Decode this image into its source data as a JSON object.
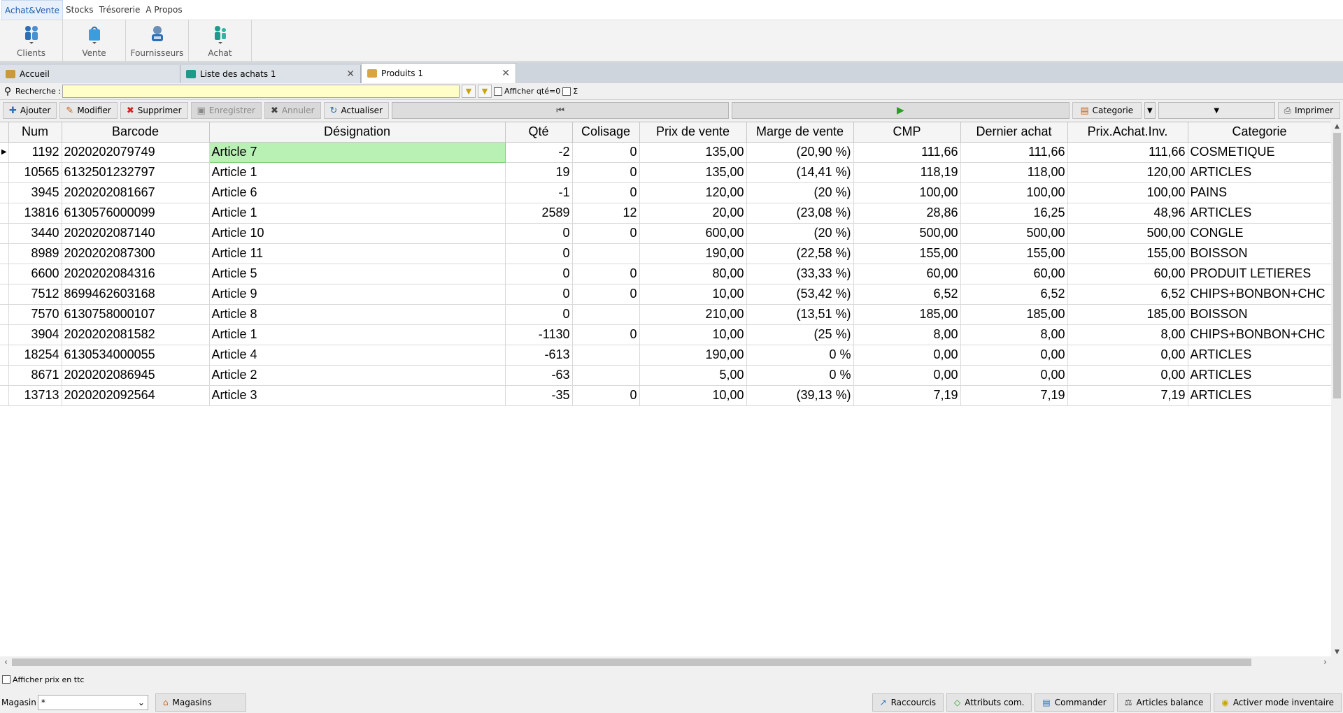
{
  "menubar": {
    "items": [
      "Achat&Vente",
      "Stocks",
      "Trésorerie",
      "A Propos"
    ]
  },
  "ribbon": {
    "buttons": [
      {
        "label": "Clients",
        "icon": "clients-icon"
      },
      {
        "label": "Vente",
        "icon": "sale-bag-icon"
      },
      {
        "label": "Fournisseurs",
        "icon": "suppliers-icon"
      },
      {
        "label": "Achat",
        "icon": "purchase-icon"
      }
    ]
  },
  "tabs": [
    {
      "label": "Accueil",
      "closable": false
    },
    {
      "label": "Liste des achats 1",
      "closable": true
    },
    {
      "label": "Produits 1",
      "closable": true,
      "active": true
    }
  ],
  "search": {
    "label": "Recherche :",
    "value": "",
    "show_zero_qty_label": "Afficher qté=0",
    "sigma": "Σ"
  },
  "toolbar": {
    "add": "Ajouter",
    "edit": "Modifier",
    "delete": "Supprimer",
    "save": "Enregistrer",
    "cancel": "Annuler",
    "refresh": "Actualiser",
    "category": "Categorie",
    "print": "Imprimer"
  },
  "grid": {
    "columns": [
      "Num",
      "Barcode",
      "Désignation",
      "Qté",
      "Colisage",
      "Prix de vente",
      "Marge de vente",
      "CMP",
      "Dernier achat",
      "Prix.Achat.Inv.",
      "Categorie"
    ],
    "rows": [
      [
        "1192",
        "2020202079749",
        "Article 7",
        "-2",
        "0",
        "135,00",
        "(20,90 %)",
        "111,66",
        "111,66",
        "111,66",
        "COSMETIQUE"
      ],
      [
        "10565",
        "6132501232797",
        "Article 1",
        "19",
        "0",
        "135,00",
        "(14,41 %)",
        "118,19",
        "118,00",
        "120,00",
        "ARTICLES"
      ],
      [
        "3945",
        "2020202081667",
        "Article 6",
        "-1",
        "0",
        "120,00",
        "(20 %)",
        "100,00",
        "100,00",
        "100,00",
        "PAINS"
      ],
      [
        "13816",
        "6130576000099",
        "Article 1",
        "2589",
        "12",
        "20,00",
        "(23,08 %)",
        "28,86",
        "16,25",
        "48,96",
        "ARTICLES"
      ],
      [
        "3440",
        "2020202087140",
        "Article 10",
        "0",
        "0",
        "600,00",
        "(20 %)",
        "500,00",
        "500,00",
        "500,00",
        "CONGLE"
      ],
      [
        "8989",
        "2020202087300",
        "Article 11",
        "0",
        "",
        "190,00",
        "(22,58 %)",
        "155,00",
        "155,00",
        "155,00",
        "BOISSON"
      ],
      [
        "6600",
        "2020202084316",
        "Article 5",
        "0",
        "0",
        "80,00",
        "(33,33 %)",
        "60,00",
        "60,00",
        "60,00",
        "PRODUIT LETIERES"
      ],
      [
        "7512",
        "8699462603168",
        "Article 9",
        "0",
        "0",
        "10,00",
        "(53,42 %)",
        "6,52",
        "6,52",
        "6,52",
        "CHIPS+BONBON+CHC"
      ],
      [
        "7570",
        "6130758000107",
        "Article 8",
        "0",
        "",
        "210,00",
        "(13,51 %)",
        "185,00",
        "185,00",
        "185,00",
        "BOISSON"
      ],
      [
        "3904",
        "2020202081582",
        "Article 1",
        "-1130",
        "0",
        "10,00",
        "(25 %)",
        "8,00",
        "8,00",
        "8,00",
        "CHIPS+BONBON+CHC"
      ],
      [
        "18254",
        "6130534000055",
        "Article 4",
        "-613",
        "",
        "190,00",
        "0 %",
        "0,00",
        "0,00",
        "0,00",
        "ARTICLES"
      ],
      [
        "8671",
        "2020202086945",
        "Article 2",
        "-63",
        "",
        "5,00",
        "0 %",
        "0,00",
        "0,00",
        "0,00",
        "ARTICLES"
      ],
      [
        "13713",
        "2020202092564",
        "Article 3",
        "-35",
        "0",
        "10,00",
        "(39,13 %)",
        "7,19",
        "7,19",
        "7,19",
        "ARTICLES"
      ]
    ]
  },
  "bottom": {
    "ttc_label": "Afficher prix en ttc",
    "magasin_label": "Magasin",
    "magasin_value": "*",
    "magasins_button": "Magasins",
    "shortcuts": "Raccourcis",
    "attributes": "Attributs com.",
    "order": "Commander",
    "balance": "Articles balance",
    "inventory": "Activer mode inventaire"
  },
  "colors": {
    "accent": "#1e5ea8",
    "selected_cell": "#b9f0b4",
    "search_bg": "#fffec8",
    "green_arrow": "#2a9d22"
  }
}
